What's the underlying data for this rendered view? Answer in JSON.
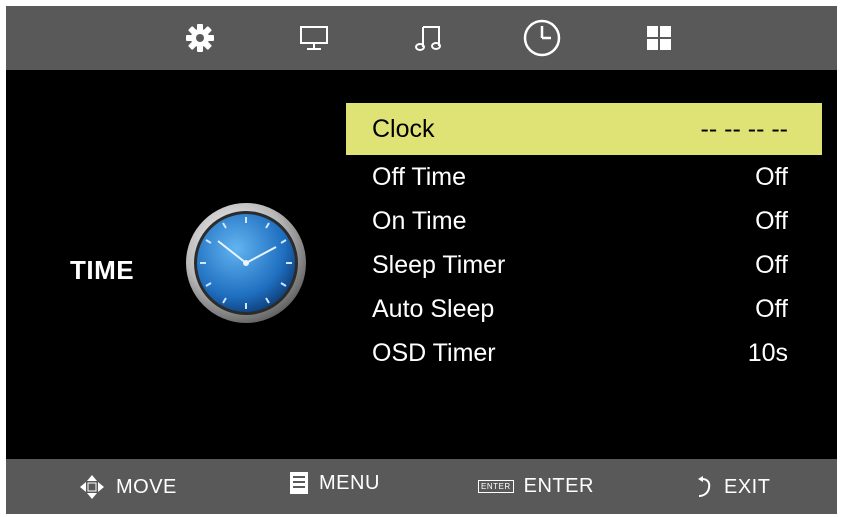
{
  "tabs": [
    {
      "name": "settings-gear-icon"
    },
    {
      "name": "monitor-icon"
    },
    {
      "name": "music-note-icon"
    },
    {
      "name": "clock-icon",
      "active": true
    },
    {
      "name": "grid-icon"
    }
  ],
  "section": {
    "title": "TIME",
    "icon": "analog-clock-icon"
  },
  "menu": {
    "items": [
      {
        "label": "Clock",
        "value": "-- -- -- --",
        "selected": true
      },
      {
        "label": "Off Time",
        "value": "Off"
      },
      {
        "label": "On Time",
        "value": "Off"
      },
      {
        "label": "Sleep Timer",
        "value": "Off"
      },
      {
        "label": "Auto Sleep",
        "value": "Off"
      },
      {
        "label": "OSD Timer",
        "value": "10s"
      }
    ]
  },
  "hints": {
    "move": "MOVE",
    "menu": "MENU",
    "enter": "ENTER",
    "enter_key": "ENTER",
    "exit": "EXIT"
  },
  "colors": {
    "bar": "#595959",
    "panel": "#000000",
    "highlight": "#dfe274",
    "clock_face": "#1f6fc0"
  }
}
